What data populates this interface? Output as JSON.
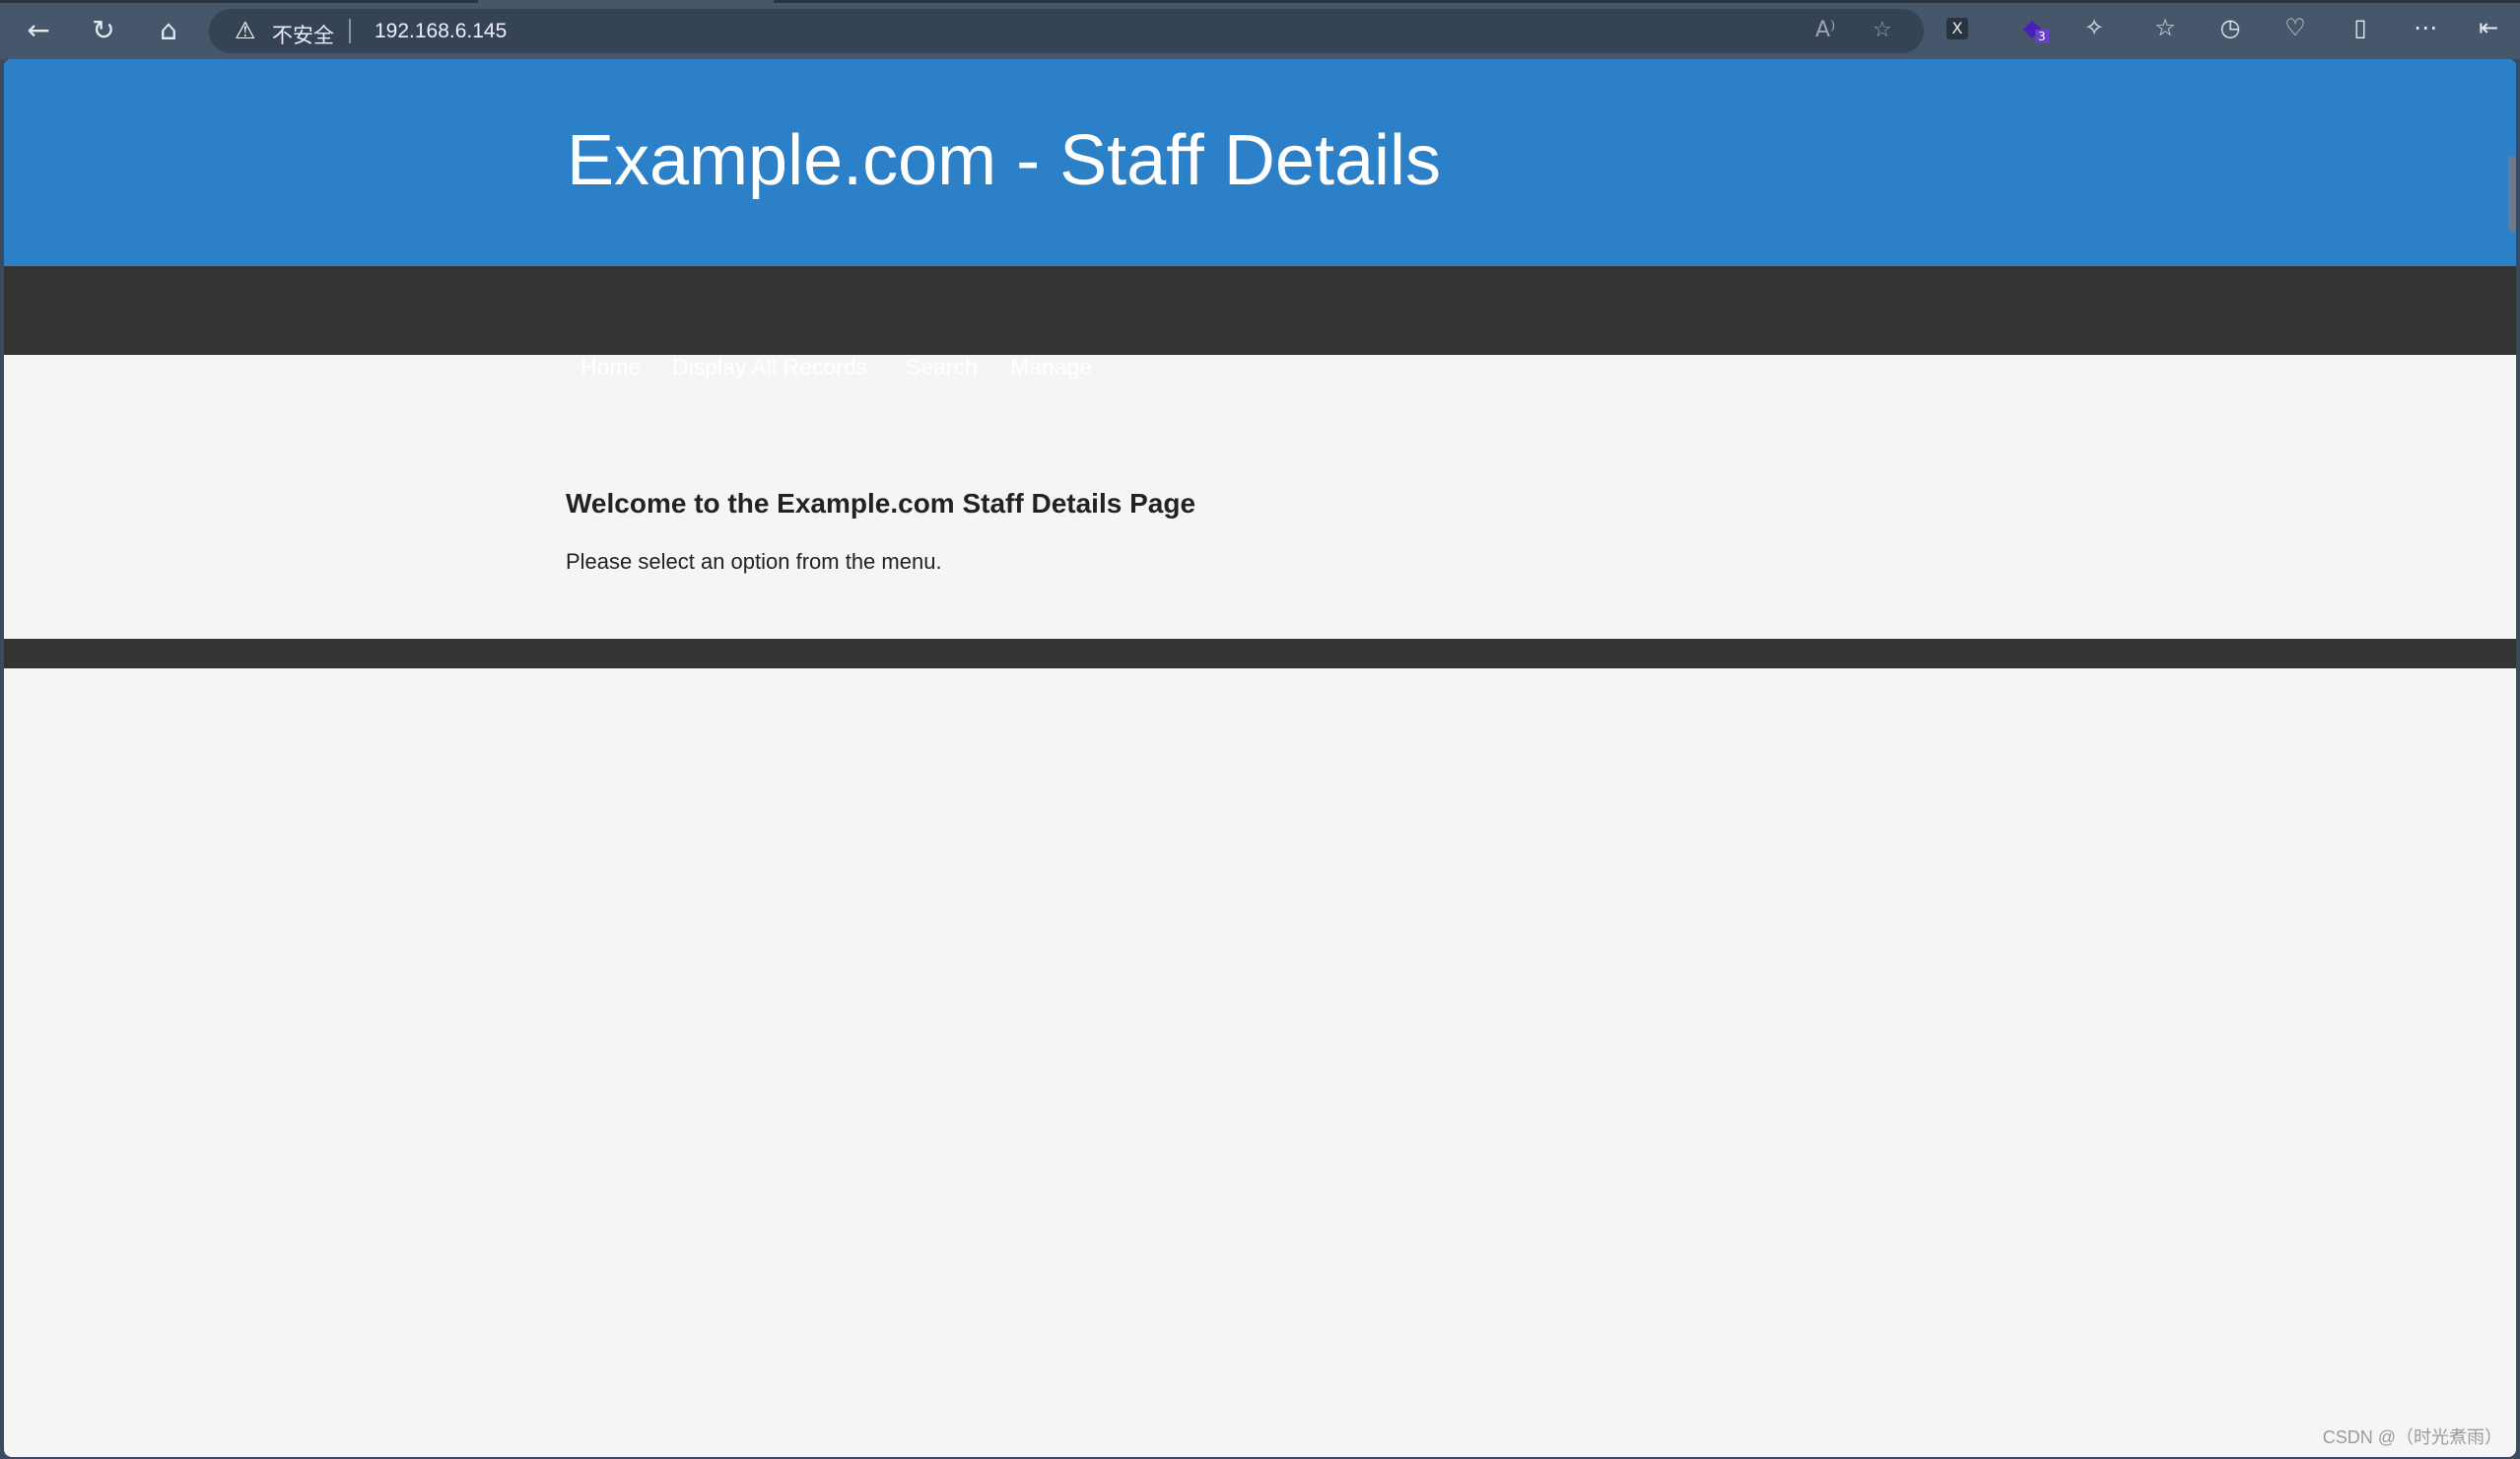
{
  "browser": {
    "security_label": "不安全",
    "url": "192.168.6.145",
    "extension_badge": "3"
  },
  "header": {
    "title": "Example.com - Staff Details"
  },
  "nav": {
    "items": [
      {
        "label": "Home"
      },
      {
        "label": "Display All Records"
      },
      {
        "label": "Search"
      },
      {
        "label": "Manage"
      }
    ]
  },
  "content": {
    "heading": "Welcome to the Example.com Staff Details Page",
    "text": "Please select an option from the menu."
  },
  "watermark": "CSDN @（时光煮雨）",
  "colors": {
    "header": "#2b80c8",
    "nav": "#333333",
    "background": "#f5f5f5"
  }
}
